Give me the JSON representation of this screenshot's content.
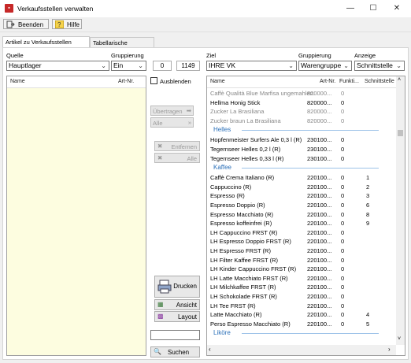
{
  "window": {
    "title": "Verkaufsstellen verwalten"
  },
  "toolbar": {
    "quit_label": "Beenden",
    "help_label": "Hilfe"
  },
  "tabs": [
    {
      "label": "Artikel zu Verkaufsstellen zuordnen",
      "active": true
    },
    {
      "label": "Tabellarische Zuordnung",
      "active": false
    }
  ],
  "source": {
    "label": "Quelle",
    "value": "Hauptlager",
    "grouping_label": "Gruppierung",
    "grouping_value": "Ein",
    "count_left": "0",
    "count_right": "1149",
    "list_headers": {
      "name": "Name",
      "artnr": "Art-Nr."
    }
  },
  "middle": {
    "hide_label": "Ausblenden",
    "transfer_label": "Übertragen",
    "all_label": "Alle",
    "remove_label": "Entfernen",
    "remove_all_label": "Alle",
    "print_label": "Drucken",
    "view_label": "Ansicht",
    "layout_label": "Layout",
    "search_label": "Suchen"
  },
  "target": {
    "label": "Ziel",
    "value": "IHRE VK",
    "grouping_label": "Gruppierung",
    "grouping_value": "Warengruppe",
    "display_label": "Anzeige",
    "display_value": "Schnittstelle",
    "headers": {
      "name": "Name",
      "artnr": "Art-Nr.",
      "funkt": "Funkti...",
      "schnitt": "Schnittstelle"
    }
  },
  "target_rows": [
    {
      "type": "item",
      "name": "Caffè Qualità Blue Marfisa ungemahlen...",
      "artnr": "820000...",
      "funkt": "0",
      "schnitt": "",
      "gray": true
    },
    {
      "type": "item",
      "name": "Hellma Honig Stick",
      "artnr": "820000...",
      "funkt": "0",
      "schnitt": "",
      "gray": false
    },
    {
      "type": "item",
      "name": "Zucker La Brasiliana",
      "artnr": "820000...",
      "funkt": "0",
      "schnitt": "",
      "gray": true
    },
    {
      "type": "item",
      "name": "Zucker braun La Brasiliana",
      "artnr": "820000...",
      "funkt": "0",
      "schnitt": "",
      "gray": true
    },
    {
      "type": "group",
      "name": "Helles"
    },
    {
      "type": "item",
      "name": "Hopfenmeister Surfers Ale 0,3 l (R)",
      "artnr": "230100...",
      "funkt": "0",
      "schnitt": "",
      "gray": false
    },
    {
      "type": "item",
      "name": "Tegernseer Helles 0,2 l (R)",
      "artnr": "230100...",
      "funkt": "0",
      "schnitt": "",
      "gray": false
    },
    {
      "type": "item",
      "name": "Tegernseer Helles 0,33 l (R)",
      "artnr": "230100...",
      "funkt": "0",
      "schnitt": "",
      "gray": false
    },
    {
      "type": "group",
      "name": "Kaffee"
    },
    {
      "type": "item",
      "name": "Caffè Crema Italiano (R)",
      "artnr": "220100...",
      "funkt": "0",
      "schnitt": "1",
      "gray": false
    },
    {
      "type": "item",
      "name": "Cappuccino (R)",
      "artnr": "220100...",
      "funkt": "0",
      "schnitt": "2",
      "gray": false
    },
    {
      "type": "item",
      "name": "Espresso (R)",
      "artnr": "220100...",
      "funkt": "0",
      "schnitt": "3",
      "gray": false
    },
    {
      "type": "item",
      "name": "Espresso Doppio (R)",
      "artnr": "220100...",
      "funkt": "0",
      "schnitt": "6",
      "gray": false
    },
    {
      "type": "item",
      "name": "Espresso Macchiato (R)",
      "artnr": "220100...",
      "funkt": "0",
      "schnitt": "8",
      "gray": false
    },
    {
      "type": "item",
      "name": "Espresso koffeinfrei (R)",
      "artnr": "220100...",
      "funkt": "0",
      "schnitt": "9",
      "gray": false
    },
    {
      "type": "item",
      "name": "LH Cappuccino FRST (R)",
      "artnr": "220100...",
      "funkt": "0",
      "schnitt": "",
      "gray": false
    },
    {
      "type": "item",
      "name": "LH Espresso Doppio FRST (R)",
      "artnr": "220100...",
      "funkt": "0",
      "schnitt": "",
      "gray": false
    },
    {
      "type": "item",
      "name": "LH Espresso FRST (R)",
      "artnr": "220100...",
      "funkt": "0",
      "schnitt": "",
      "gray": false
    },
    {
      "type": "item",
      "name": "LH Filter Kaffee FRST (R)",
      "artnr": "220100...",
      "funkt": "0",
      "schnitt": "",
      "gray": false
    },
    {
      "type": "item",
      "name": "LH Kinder Cappuccino FRST (R)",
      "artnr": "220100...",
      "funkt": "0",
      "schnitt": "",
      "gray": false
    },
    {
      "type": "item",
      "name": "LH Latte Macchiato FRST (R)",
      "artnr": "220100...",
      "funkt": "0",
      "schnitt": "",
      "gray": false
    },
    {
      "type": "item",
      "name": "LH Milchkaffee FRST (R)",
      "artnr": "220100...",
      "funkt": "0",
      "schnitt": "",
      "gray": false
    },
    {
      "type": "item",
      "name": "LH Schokolade FRST (R)",
      "artnr": "220100...",
      "funkt": "0",
      "schnitt": "",
      "gray": false
    },
    {
      "type": "item",
      "name": "LH Tee FRST (R)",
      "artnr": "220100...",
      "funkt": "0",
      "schnitt": "",
      "gray": false
    },
    {
      "type": "item",
      "name": "Latte Macchiato (R)",
      "artnr": "220100...",
      "funkt": "0",
      "schnitt": "4",
      "gray": false
    },
    {
      "type": "item",
      "name": "Perso Espresso Macchiato (R)",
      "artnr": "220100...",
      "funkt": "0",
      "schnitt": "5",
      "gray": false
    },
    {
      "type": "group",
      "name": "Liköre"
    }
  ],
  "colors": {
    "source_list_bg": "#fdfde0",
    "group_text": "#2a6fb8",
    "app_icon": "#c62828"
  }
}
